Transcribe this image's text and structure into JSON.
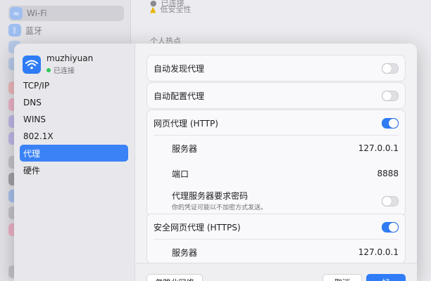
{
  "background": {
    "sidebar": {
      "wifi_label": "Wi-Fi",
      "bluetooth_label": "蓝牙"
    },
    "status_lines": [
      "已连接",
      "低安全性"
    ],
    "hotspot_label": "个人热点"
  },
  "dialog": {
    "network": {
      "name": "muzhiyuan",
      "status": "已连接"
    },
    "tabs": [
      "TCP/IP",
      "DNS",
      "WINS",
      "802.1X",
      "代理",
      "硬件"
    ],
    "active_tab_index": 4,
    "rows": {
      "auto_discover": {
        "label": "自动发现代理",
        "enabled": false
      },
      "auto_config": {
        "label": "自动配置代理",
        "enabled": false
      },
      "http": {
        "label": "网页代理 (HTTP)",
        "enabled": true,
        "server_label": "服务器",
        "server_value": "127.0.0.1",
        "port_label": "端口",
        "port_value": "8888",
        "auth_label": "代理服务器要求密码",
        "auth_note": "你的凭证可能以不加密方式发送。",
        "auth_enabled": false
      },
      "https": {
        "label": "安全网页代理 (HTTPS)",
        "enabled": true,
        "server_label": "服务器",
        "server_value": "127.0.0.1"
      }
    },
    "footer": {
      "forget_label": "忽略此网络",
      "cancel_label": "取消",
      "ok_label": "好"
    }
  },
  "colors": {
    "accent": "#2f7cf6",
    "connected": "#34c759"
  }
}
